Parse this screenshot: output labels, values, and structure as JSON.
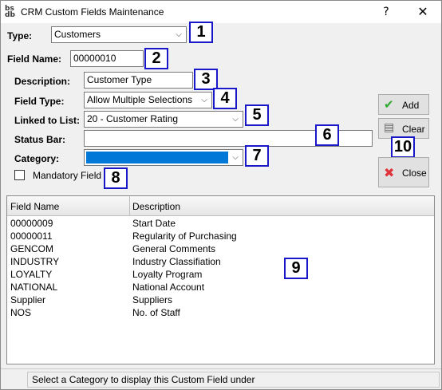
{
  "window": {
    "title": "CRM Custom Fields Maintenance",
    "icon": "app-icon",
    "help_label": "?",
    "close_label": "✕"
  },
  "form": {
    "type": {
      "label": "Type:",
      "value": "Customers"
    },
    "field_name": {
      "label": "Field Name:",
      "value": "00000010"
    },
    "description": {
      "label": "Description:",
      "value": "Customer Type"
    },
    "field_type": {
      "label": "Field Type:",
      "value": "Allow Multiple Selections"
    },
    "linked_to_list": {
      "label": "Linked to List:",
      "value": "20 - Customer Rating"
    },
    "status_bar": {
      "label": "Status Bar:",
      "value": ""
    },
    "category": {
      "label": "Category:",
      "value": ""
    },
    "mandatory": {
      "label": "Mandatory Field",
      "checked": false
    }
  },
  "buttons": {
    "add": {
      "label": "Add",
      "icon": "check-icon"
    },
    "clear": {
      "label": "Clear",
      "icon": "clear-icon"
    },
    "close": {
      "label": "Close",
      "icon": "close-icon"
    }
  },
  "grid": {
    "columns": [
      "Field Name",
      "Description"
    ],
    "rows": [
      [
        "00000009",
        "Start Date"
      ],
      [
        "00000011",
        "Regularity of Purchasing"
      ],
      [
        "GENCOM",
        "General Comments"
      ],
      [
        "INDUSTRY",
        "Industry Classifiation"
      ],
      [
        "LOYALTY",
        "Loyalty Program"
      ],
      [
        "NATIONAL",
        "National Account"
      ],
      [
        "Supplier",
        "Suppliers"
      ],
      [
        "NOS",
        "No. of Staff"
      ]
    ]
  },
  "annotations": [
    "1",
    "2",
    "3",
    "4",
    "5",
    "6",
    "7",
    "8",
    "9",
    "10"
  ],
  "status": {
    "text": "Select a Category to display this Custom Field under"
  },
  "colors": {
    "annotation_border": "#1818c8",
    "selection": "#0078d7"
  }
}
